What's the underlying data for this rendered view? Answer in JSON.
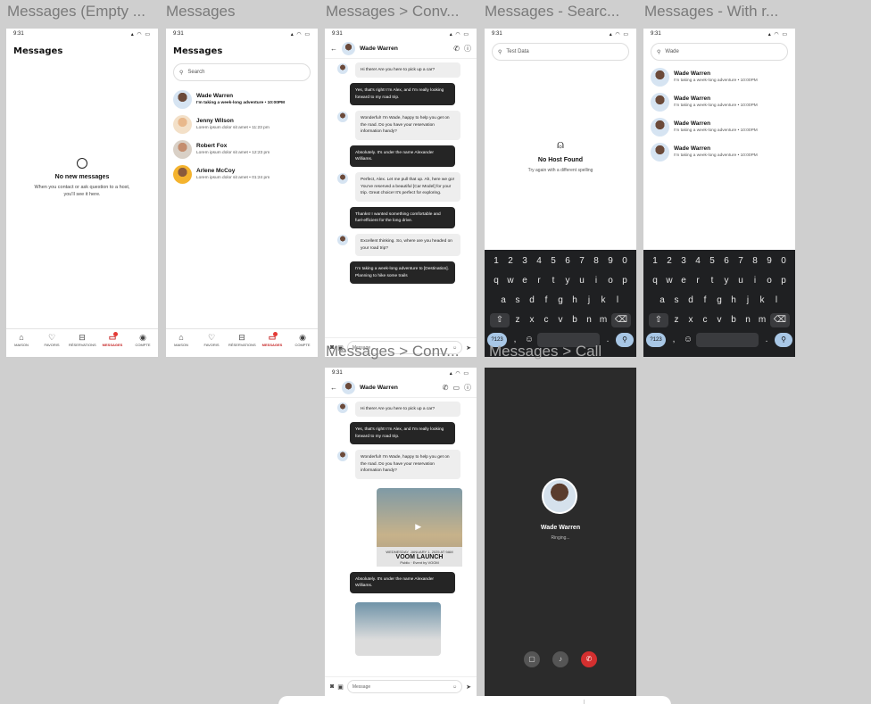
{
  "frames": {
    "f1": "Messages (Empty ...",
    "f2": "Messages",
    "f3": "Messages > Conv...",
    "f4": "Messages - Searc...",
    "f5": "Messages - With r...",
    "f6": "Messages > Conv...",
    "f7": "Messages > Call"
  },
  "status_time": "9:31",
  "page_title": "Messages",
  "empty": {
    "title": "No new messages",
    "desc": "When you contact or ask question to a host, you'll see it here."
  },
  "nav": [
    "MAISON",
    "FAVORIS",
    "RÉSERVATIONS",
    "MESSAGES",
    "COMPTE"
  ],
  "search_placeholder": "Search",
  "conversations": [
    {
      "name": "Wade Warren",
      "preview": "I'm taking a week-long adventure • 10:00PM"
    },
    {
      "name": "Jenny Wilson",
      "preview": "Lorem ipsum dolor sit amet • 11:23 pm"
    },
    {
      "name": "Robert Fox",
      "preview": "Lorem ipsum dolor sit amet • 12:23 pm"
    },
    {
      "name": "Arlene McCoy",
      "preview": "Lorem ipsum dolor sit amet • 01:24 pm"
    }
  ],
  "chat": {
    "name": "Wade Warren",
    "messages": [
      "Hi there! Are you here to pick up a car?",
      "Yes, that's right! I'm Alex, and I'm really looking forward to my road trip.",
      "Wonderful! I'm Wade, happy to help you get on the road. Do you have your reservation information handy?",
      "Absolutely. It's under the name Alexander Williams.",
      "Perfect, Alex. Let me pull that up. Ah, here we go! You've reserved a beautiful [Car Model] for your trip. Great choice! It's perfect for exploring.",
      "Thanks! I wanted something comfortable and fuel-efficient for the long drive.",
      "Excellent thinking. So, where are you headed on your road trip?",
      "I'm taking a week-long adventure to [Destination]. Planning to hike some trails"
    ],
    "input_placeholder": "Message"
  },
  "search_no_result": {
    "query": "Test Data",
    "title": "No Host Found",
    "desc": "Try again with a different spelling"
  },
  "search_results": {
    "query": "Wade",
    "items": [
      {
        "name": "Wade Warren",
        "preview": "I'm taking a week-long adventure • 10:00PM"
      },
      {
        "name": "Wade Warren",
        "preview": "I'm taking a week-long adventure • 10:00PM"
      },
      {
        "name": "Wade Warren",
        "preview": "I'm taking a week-long adventure • 10:00PM"
      },
      {
        "name": "Wade Warren",
        "preview": "I'm taking a week-long adventure • 10:00PM"
      }
    ]
  },
  "keyboard": {
    "row1": [
      "1",
      "2",
      "3",
      "4",
      "5",
      "6",
      "7",
      "8",
      "9",
      "0"
    ],
    "row2": [
      "q",
      "w",
      "e",
      "r",
      "t",
      "y",
      "u",
      "i",
      "o",
      "p"
    ],
    "row3": [
      "a",
      "s",
      "d",
      "f",
      "g",
      "h",
      "j",
      "k",
      "l"
    ],
    "row4": [
      "z",
      "x",
      "c",
      "v",
      "b",
      "n",
      "m"
    ],
    "num_key": "?123"
  },
  "media_event": {
    "date": "WEDNESDAY, JANUARY 1, 2025 AT 9AM",
    "title": "VOOM LAUNCH",
    "sub": "Public · Event by VOOM"
  },
  "call": {
    "name": "Wade Warren",
    "status": "Ringing..."
  }
}
